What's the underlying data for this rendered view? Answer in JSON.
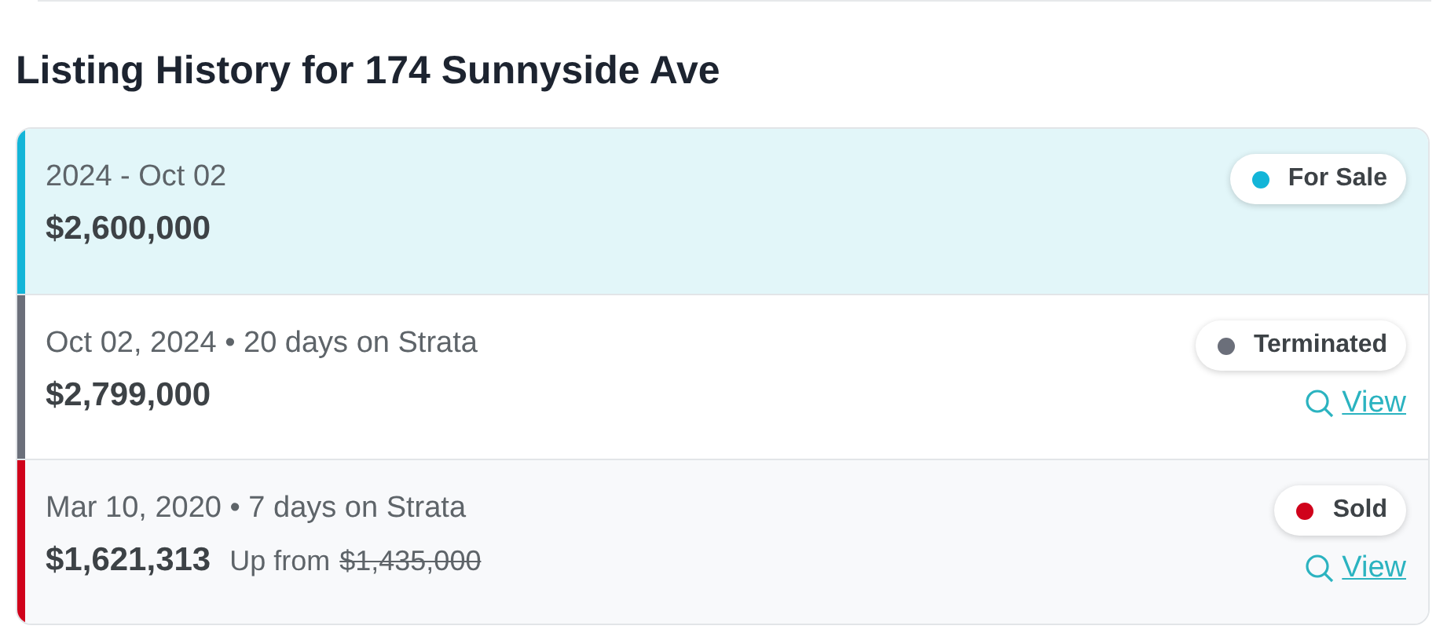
{
  "title": "Listing History for 174 Sunnyside Ave",
  "listings": [
    {
      "date": "2024 - Oct 02",
      "price": "$2,600,000",
      "status": "For Sale",
      "color": "#13b5d8",
      "selected": true
    },
    {
      "date": "Oct 02, 2024 • 20 days on Strata",
      "price": "$2,799,000",
      "status": "Terminated",
      "color": "#6b6f7a",
      "selected": false,
      "link": "View"
    },
    {
      "date": "Mar 10, 2020 • 7 days on Strata",
      "price": "$1,621,313",
      "note": "Up from",
      "previous_price": "$1,435,000",
      "status": "Sold",
      "color": "#d0021b",
      "selected": false,
      "link": "View"
    }
  ]
}
